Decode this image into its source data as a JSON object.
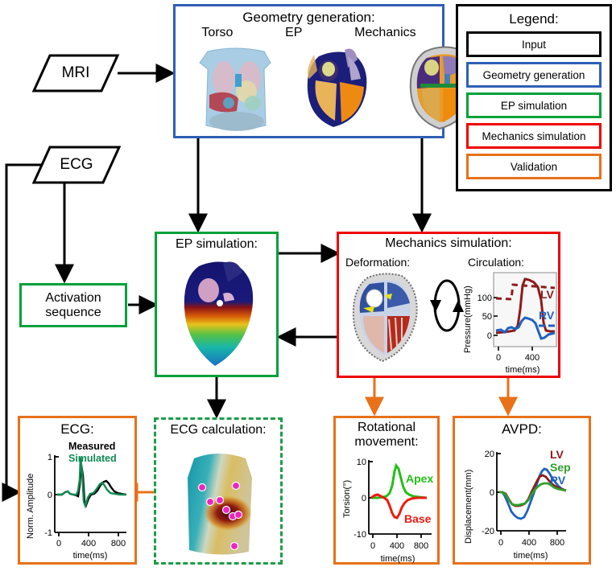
{
  "inputs": {
    "mri": "MRI",
    "ecg": "ECG"
  },
  "geometry": {
    "title": "Geometry generation:",
    "panels": [
      "Torso",
      "EP",
      "Mechanics"
    ]
  },
  "legend": {
    "title": "Legend:",
    "items": [
      {
        "label": "Input",
        "color": "#000000"
      },
      {
        "label": "Geometry generation",
        "color": "#2f5fb5"
      },
      {
        "label": "EP simulation",
        "color": "#00a13a"
      },
      {
        "label": "Mechanics simulation",
        "color": "#f00000"
      },
      {
        "label": "Validation",
        "color": "#e8711a"
      }
    ]
  },
  "activation": {
    "line1": "Activation",
    "line2": "sequence"
  },
  "ep_simulation": {
    "title": "EP simulation:"
  },
  "mechanics": {
    "title": "Mechanics simulation:",
    "deformation_label": "Deformation:",
    "circulation_label": "Circulation:"
  },
  "ecg_calculation": {
    "title": "ECG calculation:"
  },
  "validation": {
    "ecg_title": "ECG:",
    "rotational_title_line1": "Rotational",
    "rotational_title_line2": "movement:",
    "avpd_title": "AVPD:"
  },
  "chart_data": [
    {
      "type": "line",
      "name": "circulation",
      "title": "Circulation:",
      "xlabel": "time(ms)",
      "ylabel": "Pressure(mmHg)",
      "xticks": [
        0,
        400
      ],
      "yticks": [
        0,
        50,
        100
      ],
      "xlim": [
        0,
        600
      ],
      "ylim": [
        -10,
        145
      ],
      "grid": false,
      "legend_position": "inside-right",
      "series": [
        {
          "name": "LV",
          "color": "#8f1a1a",
          "style": "solid",
          "x": [
            0,
            40,
            80,
            110,
            140,
            170,
            200,
            220,
            240,
            255,
            265,
            275,
            290,
            310,
            330,
            350,
            370,
            385,
            400,
            420,
            440,
            470,
            500,
            540,
            580,
            600
          ],
          "y": [
            8,
            9,
            10,
            12,
            14,
            13,
            12,
            14,
            25,
            60,
            110,
            135,
            141,
            139,
            136,
            132,
            127,
            120,
            95,
            28,
            10,
            6,
            6,
            7,
            8,
            8
          ]
        },
        {
          "name": "LV-ref",
          "color": "#8f1a1a",
          "style": "dashed",
          "x": [
            0,
            100,
            200,
            300,
            400,
            500,
            600
          ],
          "y": [
            100,
            98,
            96,
            131,
            128,
            124,
            120
          ]
        },
        {
          "name": "RV",
          "color": "#1f62c0",
          "style": "solid",
          "x": [
            0,
            30,
            60,
            90,
            120,
            150,
            180,
            210,
            240,
            260,
            275,
            290,
            310,
            330,
            350,
            370,
            390,
            410,
            430,
            460,
            500,
            540,
            580,
            600
          ],
          "y": [
            14,
            16,
            13,
            11,
            18,
            20,
            16,
            14,
            20,
            35,
            46,
            47,
            44,
            40,
            36,
            32,
            28,
            20,
            2,
            -5,
            -2,
            3,
            6,
            7
          ]
        },
        {
          "name": "RV-ref",
          "color": "#1f62c0",
          "style": "dashed",
          "x": [
            380,
            600
          ],
          "y": [
            22,
            22
          ]
        }
      ],
      "annotations": [
        {
          "text": "LV",
          "color": "#8f1a1a"
        },
        {
          "text": "RV",
          "color": "#1f62c0"
        }
      ]
    },
    {
      "type": "line",
      "name": "ecg",
      "title": "ECG:",
      "xlabel": "time(ms)",
      "ylabel": "Norm. Amplitude",
      "xticks": [
        0,
        400,
        800
      ],
      "yticks": [
        -1,
        0,
        1
      ],
      "xlim": [
        0,
        850
      ],
      "ylim": [
        -1,
        1
      ],
      "grid": false,
      "legend_position": "top-right",
      "series": [
        {
          "name": "Measured",
          "color": "#000000",
          "style": "solid",
          "x": [
            0,
            30,
            60,
            90,
            110,
            130,
            150,
            170,
            185,
            195,
            205,
            212,
            218,
            224,
            232,
            240,
            250,
            262,
            275,
            290,
            310,
            330,
            350,
            370,
            390,
            405,
            420,
            435,
            450,
            470,
            490,
            520,
            560,
            610,
            670,
            740,
            800,
            850
          ],
          "y": [
            0,
            0,
            0.02,
            0.07,
            0.1,
            0.06,
            0,
            0,
            -0.03,
            -0.05,
            0.1,
            0.6,
            0.95,
            0.55,
            -0.1,
            -0.28,
            -0.12,
            0,
            0.02,
            0.02,
            0.05,
            0.12,
            0.22,
            0.32,
            0.38,
            0.39,
            0.36,
            0.3,
            0.22,
            0.14,
            0.09,
            0.06,
            0.04,
            0.03,
            0.02,
            0.02,
            0.01,
            0.01
          ]
        },
        {
          "name": "Simulated",
          "color": "#0e8a54",
          "style": "solid",
          "x": [
            0,
            30,
            60,
            90,
            110,
            130,
            150,
            170,
            185,
            195,
            203,
            210,
            216,
            222,
            230,
            238,
            248,
            260,
            272,
            288,
            305,
            325,
            345,
            362,
            378,
            392,
            405,
            420,
            435,
            455,
            480,
            520,
            570,
            630,
            700,
            780,
            850
          ],
          "y": [
            0,
            0,
            0.01,
            0.05,
            0.08,
            0.05,
            0,
            0,
            -0.02,
            0,
            0.2,
            0.7,
            1.0,
            0.5,
            -0.15,
            -0.3,
            -0.1,
            0.02,
            0.03,
            0.04,
            0.1,
            0.2,
            0.3,
            0.33,
            0.3,
            0.22,
            0.14,
            0.08,
            0.05,
            0.03,
            0.02,
            0.01,
            0.01,
            0.01,
            0.0,
            0.0,
            0.0
          ]
        }
      ],
      "annotations": [
        {
          "text": "Measured",
          "color": "#000000"
        },
        {
          "text": "Simulated",
          "color": "#0e8a54"
        }
      ]
    },
    {
      "type": "line",
      "name": "rotational_movement",
      "title": "Rotational movement:",
      "xlabel": "time(ms)",
      "ylabel": "Torsion(°)",
      "xticks": [
        0,
        400,
        800
      ],
      "yticks": [
        -10,
        0,
        10
      ],
      "xlim": [
        0,
        850
      ],
      "ylim": [
        -10,
        10
      ],
      "grid": false,
      "legend_position": "inside",
      "series": [
        {
          "name": "Apex",
          "color": "#22c017",
          "style": "solid",
          "x": [
            0,
            50,
            100,
            150,
            200,
            240,
            280,
            310,
            340,
            360,
            375,
            390,
            405,
            420,
            440,
            460,
            490,
            520,
            560,
            610,
            670,
            740,
            800,
            850
          ],
          "y": [
            0,
            0,
            0,
            0.1,
            0.2,
            0.3,
            0.6,
            1.6,
            4.2,
            7.0,
            8.6,
            8.9,
            8.0,
            6.2,
            4.0,
            2.5,
            1.4,
            0.8,
            0.4,
            0.2,
            0.1,
            0.05,
            0,
            0
          ]
        },
        {
          "name": "Base",
          "color": "#ee1b12",
          "style": "solid",
          "x": [
            0,
            40,
            80,
            110,
            140,
            170,
            200,
            230,
            260,
            285,
            305,
            325,
            345,
            360,
            375,
            390,
            410,
            430,
            455,
            485,
            520,
            570,
            630,
            700,
            780,
            850
          ],
          "y": [
            0,
            0.2,
            0.7,
            1.0,
            0.9,
            0.6,
            0.3,
            -0.2,
            -1.2,
            -2.8,
            -4.2,
            -5.1,
            -5.3,
            -5.0,
            -4.2,
            -3.2,
            -2.0,
            -1.2,
            -0.7,
            -0.4,
            -0.2,
            -0.1,
            0,
            0,
            0,
            0
          ]
        }
      ],
      "annotations": [
        {
          "text": "Apex",
          "color": "#22c017"
        },
        {
          "text": "Base",
          "color": "#ee1b12"
        }
      ]
    },
    {
      "type": "line",
      "name": "avpd",
      "title": "AVPD:",
      "xlabel": "time(ms)",
      "ylabel": "Displacement(mm)",
      "xticks": [
        0,
        400,
        800
      ],
      "yticks": [
        -20,
        0,
        20
      ],
      "xlim": [
        0,
        850
      ],
      "ylim": [
        -20,
        20
      ],
      "grid": false,
      "legend_position": "top-right",
      "series": [
        {
          "name": "LV",
          "color": "#8f1a1a",
          "style": "solid",
          "x": [
            0,
            40,
            80,
            110,
            140,
            170,
            200,
            230,
            260,
            290,
            320,
            350,
            375,
            395,
            415,
            435,
            460,
            490,
            520,
            560,
            610,
            670,
            740,
            800,
            850
          ],
          "y": [
            0,
            0,
            -1,
            -3.5,
            -6,
            -7,
            -7.2,
            -7,
            -6,
            -4,
            -0.5,
            3.5,
            6.8,
            8.2,
            8.6,
            8.0,
            6.5,
            4.5,
            3.0,
            2.2,
            1.6,
            1.2,
            1.0,
            0.9,
            0.9
          ]
        },
        {
          "name": "Sep",
          "color": "#2f9e2a",
          "style": "solid",
          "x": [
            0,
            40,
            80,
            110,
            140,
            170,
            200,
            230,
            260,
            290,
            320,
            350,
            375,
            400,
            425,
            450,
            480,
            510,
            545,
            590,
            650,
            710,
            780,
            850
          ],
          "y": [
            0,
            0,
            -1.2,
            -3.8,
            -6.2,
            -6.8,
            -6.6,
            -6.4,
            -5.8,
            -4.2,
            -1.8,
            0.8,
            2.6,
            3.6,
            4.2,
            4.3,
            3.8,
            3.0,
            2.2,
            1.6,
            1.2,
            1.0,
            0.9,
            0.9
          ]
        },
        {
          "name": "RV",
          "color": "#1f62c0",
          "style": "solid",
          "x": [
            0,
            30,
            60,
            90,
            120,
            150,
            180,
            205,
            230,
            255,
            280,
            305,
            330,
            355,
            375,
            395,
            415,
            435,
            460,
            490,
            520,
            560,
            610,
            670,
            740,
            800,
            850
          ],
          "y": [
            0,
            0,
            -2,
            -6,
            -10,
            -13,
            -14,
            -14.2,
            -13.8,
            -12,
            -9,
            -5,
            -0.5,
            4.5,
            8.5,
            11.4,
            12.4,
            12.0,
            10.2,
            7.5,
            5.2,
            3.4,
            2.2,
            1.5,
            1.1,
            1.0,
            1.0
          ]
        }
      ],
      "annotations": [
        {
          "text": "LV",
          "color": "#8f1a1a"
        },
        {
          "text": "Sep",
          "color": "#2f9e2a"
        },
        {
          "text": "RV",
          "color": "#1f62c0"
        }
      ]
    }
  ]
}
